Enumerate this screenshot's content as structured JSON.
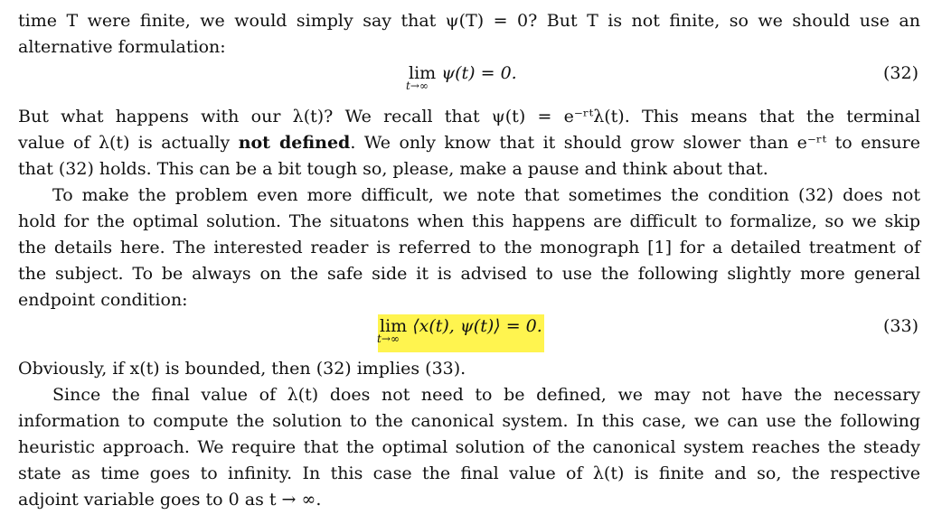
{
  "paragraph1": {
    "line1": "time T were finite, we would simply say that ψ(T) = 0? But T is not finite, so we should use an",
    "line2": "alternative formulation:"
  },
  "equation32": {
    "lim_word": "lim",
    "lim_sub": "t→∞",
    "body": "ψ(t) = 0.",
    "number": "(32)"
  },
  "paragraph2": {
    "line1": "But what happens with our λ(t)? We recall that ψ(t) = e⁻ʳᵗλ(t). This means that the terminal",
    "line2_pre": "value of λ(t) is actually ",
    "line2_bold": "not defined",
    "line2_post": ". We only know that it should grow slower than e⁻ʳᵗ to ensure",
    "line3": "that (32) holds. This can be a bit tough so, please, make a pause and think about that."
  },
  "paragraph3": {
    "line1": "To make the problem even more difficult, we note that sometimes the condition (32) does not",
    "line2": "hold for the optimal solution. The situatons when this happens are difficult to formalize, so we skip",
    "line3": "the details here. The interested reader is referred to the monograph [1] for a detailed treatment of",
    "line4": "the subject. To be always on the safe side it is advised to use the following slightly more general",
    "line5": "endpoint condition:"
  },
  "equation33": {
    "lim_word": "lim",
    "lim_sub": "t→∞",
    "body": "⟨x(t), ψ(t)⟩ = 0.",
    "number": "(33)",
    "highlight_color": "#fff44f"
  },
  "paragraph4": {
    "line1": "Obviously, if x(t) is bounded, then (32) implies (33)."
  },
  "paragraph5": {
    "line1": "Since the final value of λ(t) does not need to be defined, we may not have the necessary",
    "line2": "information to compute the solution to the canonical system. In this case, we can use the following",
    "line3": "heuristic approach. We require that the optimal solution of the canonical system reaches the steady",
    "line4": "state as time goes to infinity. In this case the final value of λ(t) is finite and so, the respective",
    "line5": "adjoint variable goes to 0 as t → ∞."
  }
}
